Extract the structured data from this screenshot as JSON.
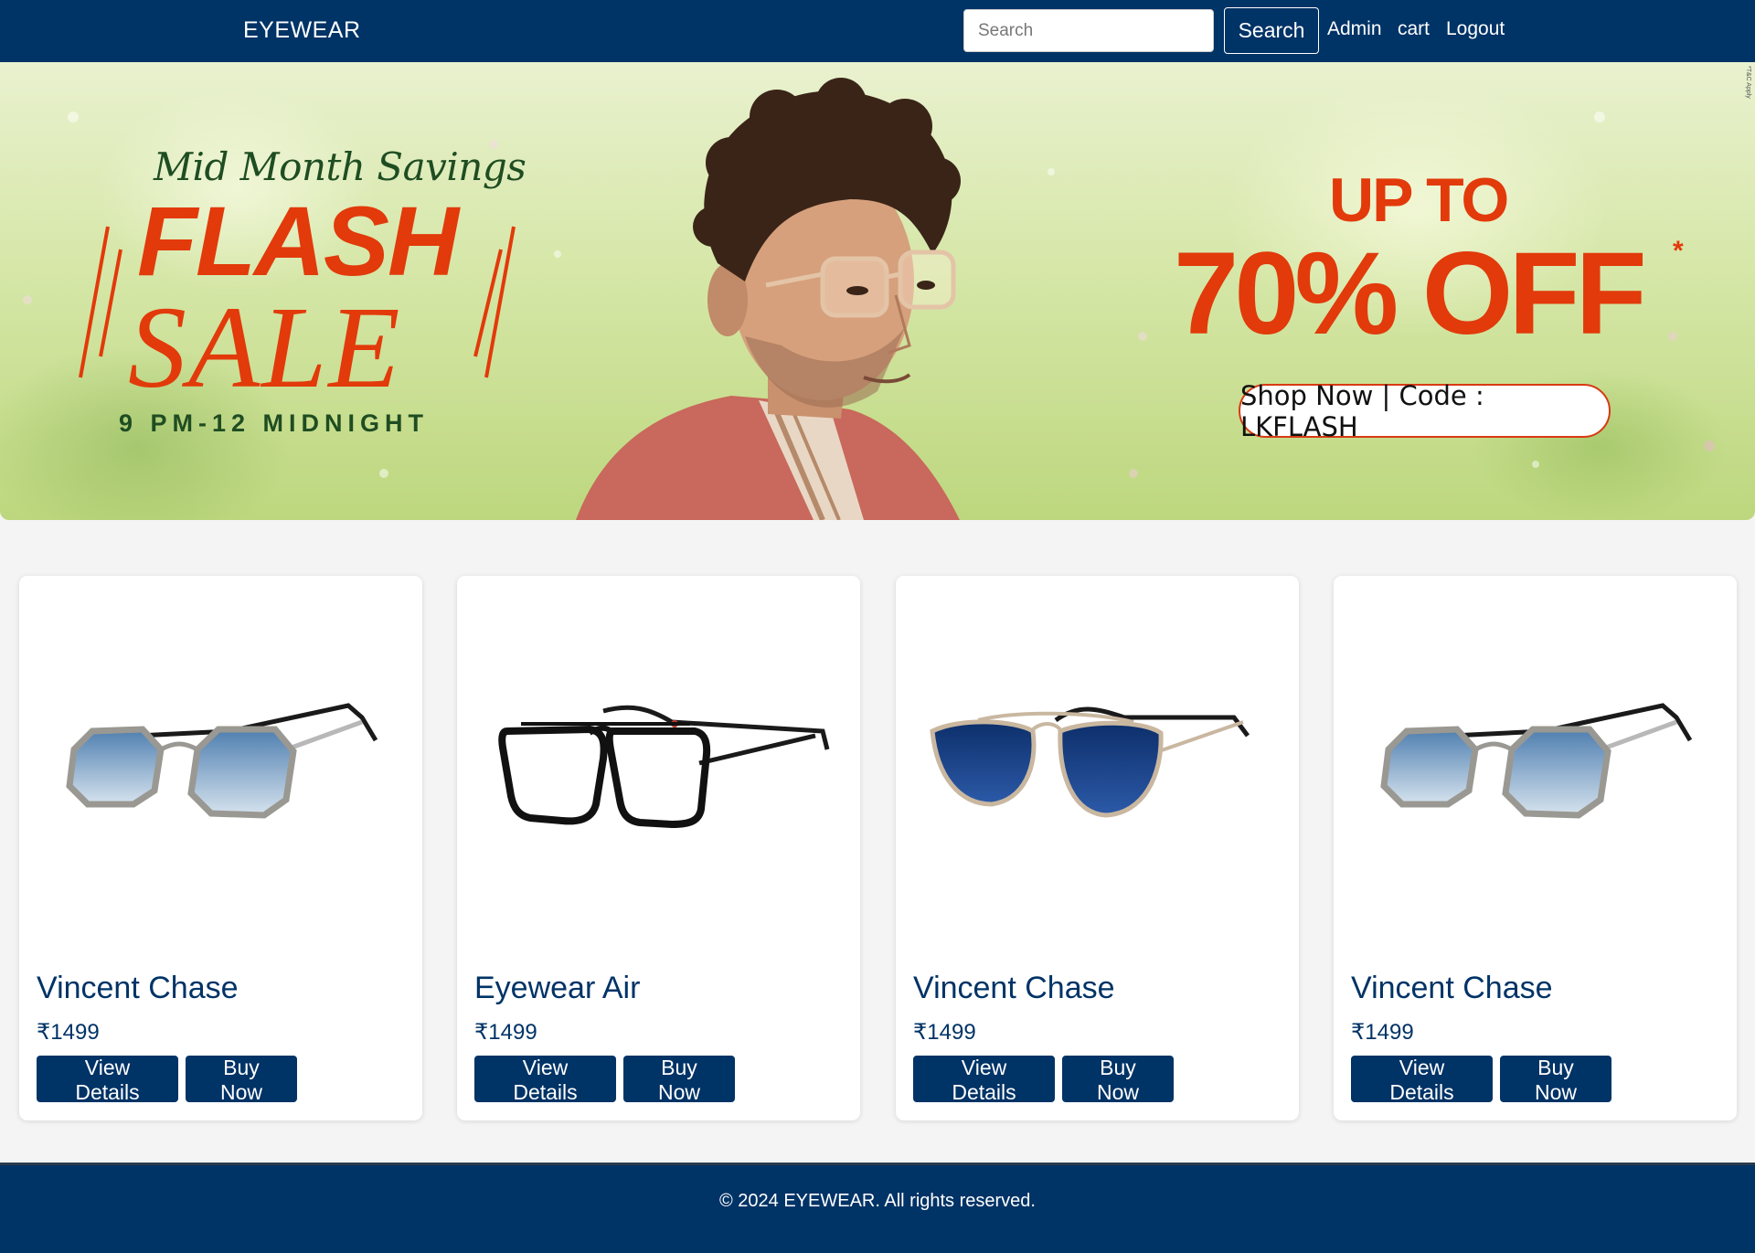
{
  "nav": {
    "brand": "EYEWEAR",
    "search_placeholder": "Search",
    "search_button": "Search",
    "links": [
      "Admin",
      "cart",
      "Logout"
    ]
  },
  "banner": {
    "kicker": "Mid Month Savings",
    "flash": "FLASH",
    "sale": "SALE",
    "time": "9 PM-12 MIDNIGHT",
    "upto": "UP TO",
    "discount": "70% OFF",
    "asterisk": "*",
    "promo": "Shop Now | Code : LKFLASH",
    "tc": "*T&C Apply"
  },
  "products": [
    {
      "name": "Vincent Chase",
      "price": "₹1499",
      "view": "View Details",
      "buy": "Buy Now",
      "image": "blue-tinted-hexagonal-sunglasses"
    },
    {
      "name": "Eyewear Air",
      "price": "₹1499",
      "view": "View Details",
      "buy": "Buy Now",
      "image": "black-rectangular-eyeglasses"
    },
    {
      "name": "Vincent Chase",
      "price": "₹1499",
      "view": "View Details",
      "buy": "Buy Now",
      "image": "blue-aviator-sunglasses"
    },
    {
      "name": "Vincent Chase",
      "price": "₹1499",
      "view": "View Details",
      "buy": "Buy Now",
      "image": "blue-tinted-hexagonal-sunglasses"
    }
  ],
  "footer": {
    "text": "© 2024 EYEWEAR. All rights reserved."
  },
  "colors": {
    "primary": "#003366",
    "sale_red": "#e23a0a",
    "sale_green": "#1f4d22",
    "page_bg": "#f4f4f4"
  }
}
